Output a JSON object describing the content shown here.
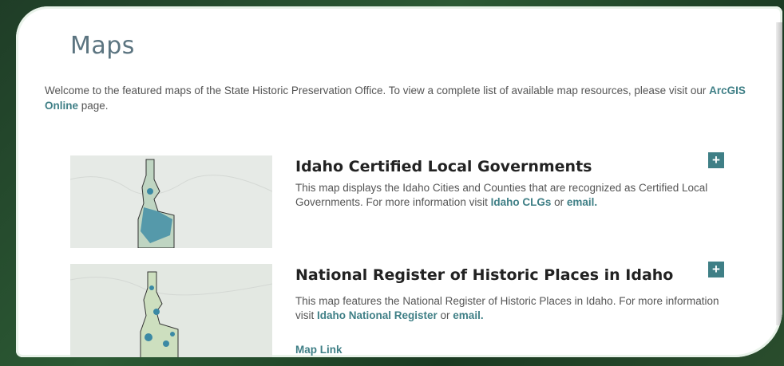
{
  "page": {
    "title": "Maps",
    "intro_before": "Welcome to the featured maps of the State Historic Preservation Office. To view a complete list of available map resources, please visit our ",
    "intro_link": "ArcGIS Online",
    "intro_after": " page."
  },
  "entries": [
    {
      "title": "Idaho Certified Local Governments",
      "desc_before": "This map displays the Idaho Cities and Counties that are recognized as Certified Local Governments. For more information visit ",
      "link1": "Idaho CLGs",
      "desc_mid": " or ",
      "link2": "email.",
      "button": "+"
    },
    {
      "title": "National Register of Historic Places in Idaho",
      "desc_before": "This map features the National Register of Historic Places in Idaho. For more information visit ",
      "link1": "Idaho National Register",
      "desc_mid": " or ",
      "link2": "email.",
      "button": "+",
      "map_link": "Map Link"
    }
  ],
  "colors": {
    "accent": "#3f7f86",
    "title": "#5b7480",
    "background": "#2c5a34"
  }
}
